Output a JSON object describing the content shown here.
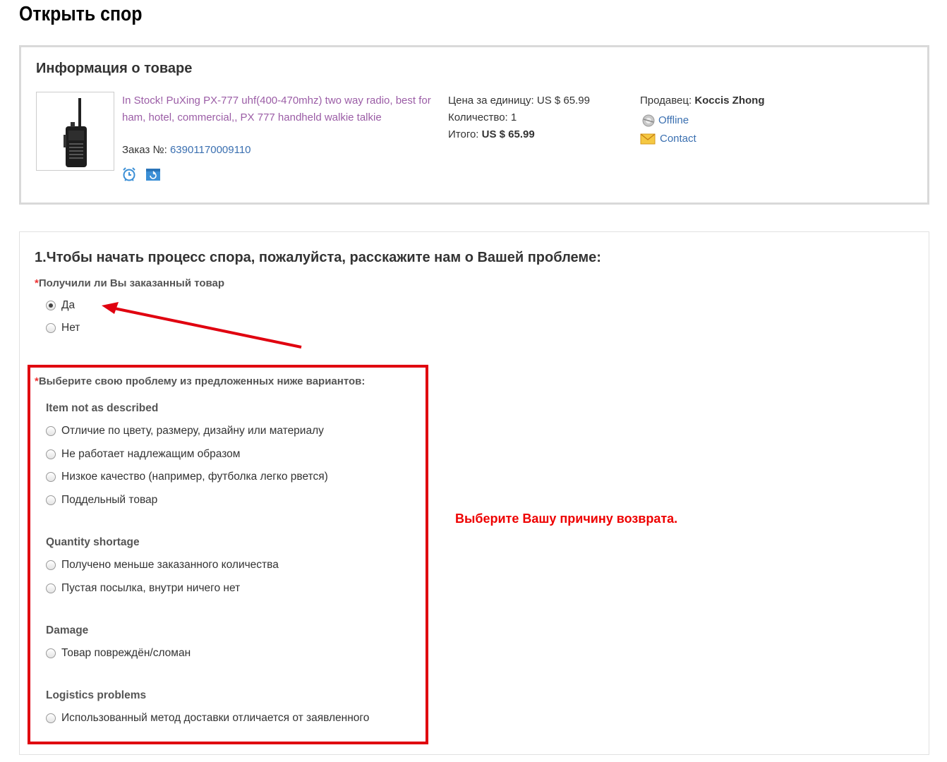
{
  "page": {
    "title": "Открыть спор"
  },
  "product_info": {
    "heading": "Информация о товаре",
    "product_name": "In Stock! PuXing PX-777 uhf(400-470mhz) two way radio, best for ham, hotel, commercial,, PX 777 handheld walkie talkie",
    "order_label": "Заказ №: ",
    "order_number": "63901170009110",
    "icons": [
      "alarm-clock-icon",
      "calendar-refresh-icon"
    ],
    "unit_price_label": "Цена за единицу: ",
    "unit_price_value": "US $ 65.99",
    "quantity_label": "Количество: ",
    "quantity_value": "1",
    "total_label": "Итого: ",
    "total_value": "US $ 65.99",
    "seller_label": "Продавец: ",
    "seller_name": "Koccis Zhong",
    "status_text": "Offline",
    "contact_text": "Contact"
  },
  "dispute_form": {
    "step_heading": "1.Чтобы начать процесс спора, пожалуйста, расскажите нам о Вашей проблеме:",
    "received_question": "Получили ли Вы заказанный товар",
    "received_options": [
      {
        "label": "Да",
        "checked": true
      },
      {
        "label": "Нет",
        "checked": false
      }
    ],
    "problem_question": "Выберите свою проблему из предложенных ниже вариантов:",
    "required_marker": "*",
    "groups": [
      {
        "title": "Item not as described",
        "options": [
          "Отличие по цвету, размеру, дизайну или материалу",
          "Не работает надлежащим образом",
          "Низкое качество (например, футболка легко рвется)",
          "Поддельный товар"
        ]
      },
      {
        "title": "Quantity shortage",
        "options": [
          "Получено меньше заказанного количества",
          "Пустая посылка, внутри ничего нет"
        ]
      },
      {
        "title": "Damage",
        "options": [
          "Товар повреждён/сломан"
        ]
      },
      {
        "title": "Logistics problems",
        "options": [
          "Использованный метод доставки отличается от заявленного"
        ]
      }
    ]
  },
  "annotation": {
    "callout_text": "Выберите Вашу причину возврата.",
    "highlight_color": "#e0000f"
  },
  "colors": {
    "link": "#3a6fb0",
    "product_name": "#9b5da6",
    "required": "#ee3333"
  }
}
